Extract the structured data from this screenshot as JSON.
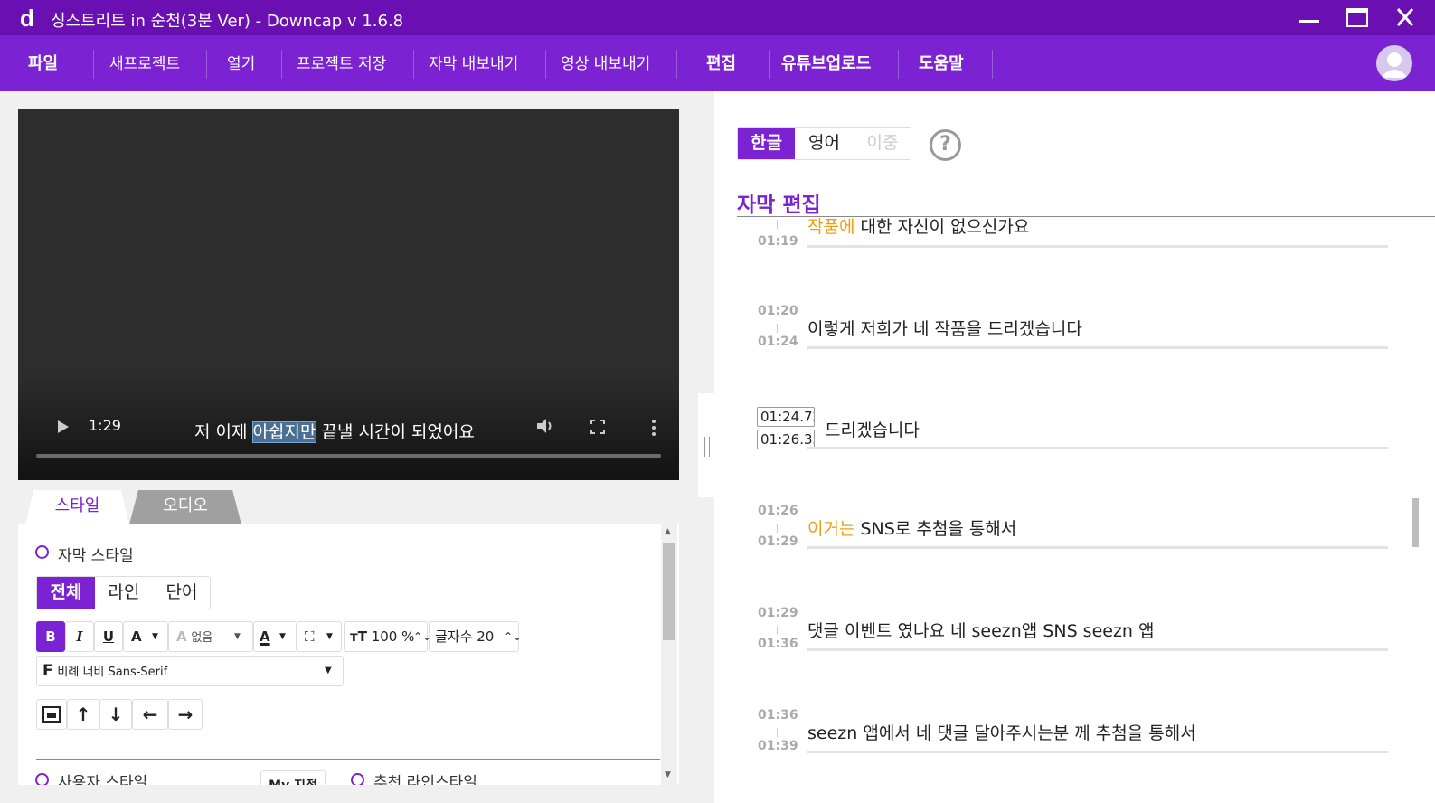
{
  "window": {
    "logo": "d",
    "title": "싱스트리트 in 순천(3분 Ver) - Downcap v 1.6.8"
  },
  "menu": {
    "file": "파일",
    "new_project": "새프로젝트",
    "open": "열기",
    "save_project": "프로젝트 저장",
    "export_subtitles": "자막 내보내기",
    "export_video": "영상 내보내기",
    "edit": "편집",
    "youtube_upload": "유튜브업로드",
    "help": "도움말"
  },
  "player": {
    "time": "1:29",
    "caption_before": "저 이제 ",
    "caption_highlight": "아쉽지만",
    "caption_after": " 끝낼 시간이 되었어요"
  },
  "tabs": {
    "style": "스타일",
    "audio": "오디오"
  },
  "style_panel": {
    "subtitle_style": "자막 스타일",
    "scope_all": "전체",
    "scope_line": "라인",
    "scope_word": "단어",
    "bold": "B",
    "italic": "I",
    "underline": "U",
    "font_color": "A",
    "outline_none": "없음",
    "size_value": "100 %",
    "char_count_label": "글자수",
    "char_count_value": "20",
    "font_name": "비례 너비 Sans-Serif",
    "user_style": "사용자 스타일",
    "my_style": "My 지정",
    "recommended_style": "추천 라인스타일"
  },
  "right_panel": {
    "lang_korean": "한글",
    "lang_english": "영어",
    "lang_dual": "이중",
    "help": "?",
    "section_title": "자막 편집"
  },
  "entries": [
    {
      "start": "",
      "end": "01:19",
      "hi": "작품에",
      "text": " 대한 자신이 없으신가요"
    },
    {
      "start": "01:20",
      "end": "01:24",
      "hi": "",
      "text": "이렇게 저희가 네 작품을 드리겠습니다"
    },
    {
      "start_box": "01:24.72",
      "end_box": "01:26.33",
      "hi": "",
      "text": "드리겠습니다"
    },
    {
      "start": "01:26",
      "end": "01:29",
      "hi": "이거는",
      "text": " SNS로 추첨을 통해서"
    },
    {
      "start": "01:29",
      "end": "01:36",
      "hi": "",
      "text": "댓글 이벤트 였나요 네 seezn앱 SNS seezn 앱"
    },
    {
      "start": "01:36",
      "end": "01:39",
      "hi": "",
      "text": "seezn 앱에서 네 댓글 달아주시는분 께 추첨을 통해서"
    }
  ],
  "colors": {
    "titlebar": "#6a0fb1",
    "menubar": "#7b22d3",
    "accent": "#7b22d3",
    "highlight_word": "#f39c12"
  }
}
